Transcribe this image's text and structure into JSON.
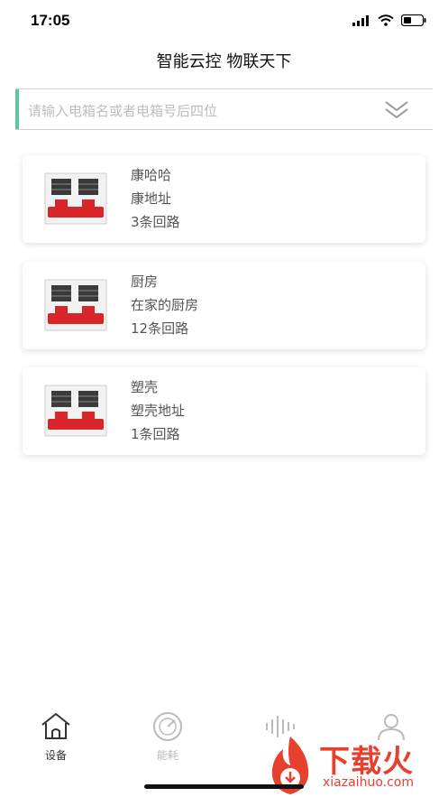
{
  "status_bar": {
    "time": "17:05"
  },
  "header": {
    "title": "智能云控 物联天下"
  },
  "search": {
    "placeholder": "请输入电箱名或者电箱号后四位"
  },
  "devices": [
    {
      "name": "康哈哈",
      "address": "康地址",
      "circuits": "3条回路"
    },
    {
      "name": "厨房",
      "address": "在家的厨房",
      "circuits": "12条回路"
    },
    {
      "name": "塑壳",
      "address": "塑壳地址",
      "circuits": "1条回路"
    }
  ],
  "tabs": [
    {
      "label": "设备",
      "icon": "home-icon",
      "active": true
    },
    {
      "label": "能耗",
      "icon": "gauge-icon",
      "active": false
    },
    {
      "label": "",
      "icon": "waveform-icon",
      "active": false
    },
    {
      "label": "",
      "icon": "user-icon",
      "active": false
    }
  ],
  "watermark": {
    "text": "下载火",
    "sub": "xiazaihuo.com"
  },
  "colors": {
    "accent": "#5cc7a6",
    "device_red": "#d9262a",
    "watermark": "#e8402f"
  }
}
